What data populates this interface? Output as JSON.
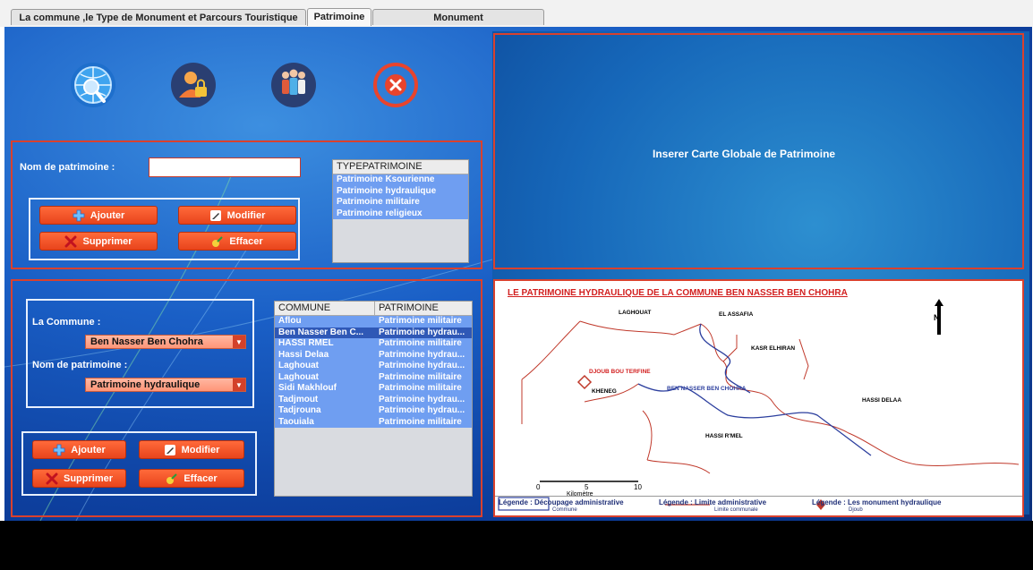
{
  "tabs": [
    {
      "label": "La commune ,le  Type de Monument et Parcours Touristique"
    },
    {
      "label": "Patrimoine"
    },
    {
      "label": "Monument"
    }
  ],
  "top_icons": [
    "globe-search-icon",
    "user-lock-icon",
    "group-users-icon",
    "close-icon"
  ],
  "form1": {
    "nom_label": "Nom de patrimoine  :",
    "nom_value": "",
    "buttons": {
      "ajouter": "Ajouter",
      "modifier": "Modifier",
      "supprimer": "Supprimer",
      "effacer": "Effacer"
    }
  },
  "type_list": {
    "header": "TYPEPATRIMOINE",
    "items": [
      "Patrimoine Ksourienne",
      "Patrimoine hydraulique",
      "Patrimoine militaire",
      "Patrimoine religieux"
    ]
  },
  "map_top": {
    "text": "Inserer  Carte  Globale de Patrimoine"
  },
  "form2": {
    "commune_label": "La Commune  :",
    "commune_value": "Ben Nasser Ben Chohra",
    "nom_label": "Nom de patrimoine :",
    "nom_value": "Patrimoine hydraulique",
    "buttons": {
      "ajouter": "Ajouter",
      "modifier": "Modifier",
      "supprimer": "Supprimer",
      "effacer": "Effacer"
    }
  },
  "table": {
    "columns": [
      "COMMUNE",
      "PATRIMOINE"
    ],
    "rows": [
      [
        "Aflou",
        "Patrimoine militaire"
      ],
      [
        "Ben Nasser Ben C...",
        "Patrimoine hydrau..."
      ],
      [
        "HASSI RMEL",
        "Patrimoine militaire"
      ],
      [
        "Hassi Delaa",
        "Patrimoine hydrau..."
      ],
      [
        "Laghouat",
        "Patrimoine hydrau..."
      ],
      [
        "Laghouat",
        "Patrimoine militaire"
      ],
      [
        "Sidi Makhlouf",
        "Patrimoine militaire"
      ],
      [
        "Tadjmout",
        "Patrimoine hydrau..."
      ],
      [
        "Tadjrouna",
        "Patrimoine hydrau..."
      ],
      [
        "Taouiala",
        "Patrimoine militaire"
      ]
    ],
    "selected_row": 1
  },
  "map_bottom": {
    "title": "LE PATRIMOINE HYDRAULIQUE DE LA COMMUNE BEN NASSER BEN CHOHRA",
    "places": [
      "LAGHOUAT",
      "EL ASSAFIA",
      "KASR ELHIRAN",
      "DJOUB BOU TERFINE",
      "BEN NASSER BEN CHOHRA",
      "KHENEG",
      "HASSI DELAA",
      "HASSI R'MEL"
    ],
    "scale_ticks": [
      "0",
      "5",
      "10"
    ],
    "scale_unit": "Kilomètre",
    "compass": "N",
    "legend": [
      {
        "title": "Légende : Découpage administrative",
        "item": "Commune"
      },
      {
        "title": "Légende : Limite administrative",
        "item": "Limite communale"
      },
      {
        "title": "Légende : Les monument hydraulique",
        "item": "Djoub"
      }
    ]
  },
  "colors": {
    "accent_red": "#e8441c",
    "border_red": "#d9412e",
    "list_blue": "#6f9ef1",
    "selection_blue": "#2f58b6"
  }
}
